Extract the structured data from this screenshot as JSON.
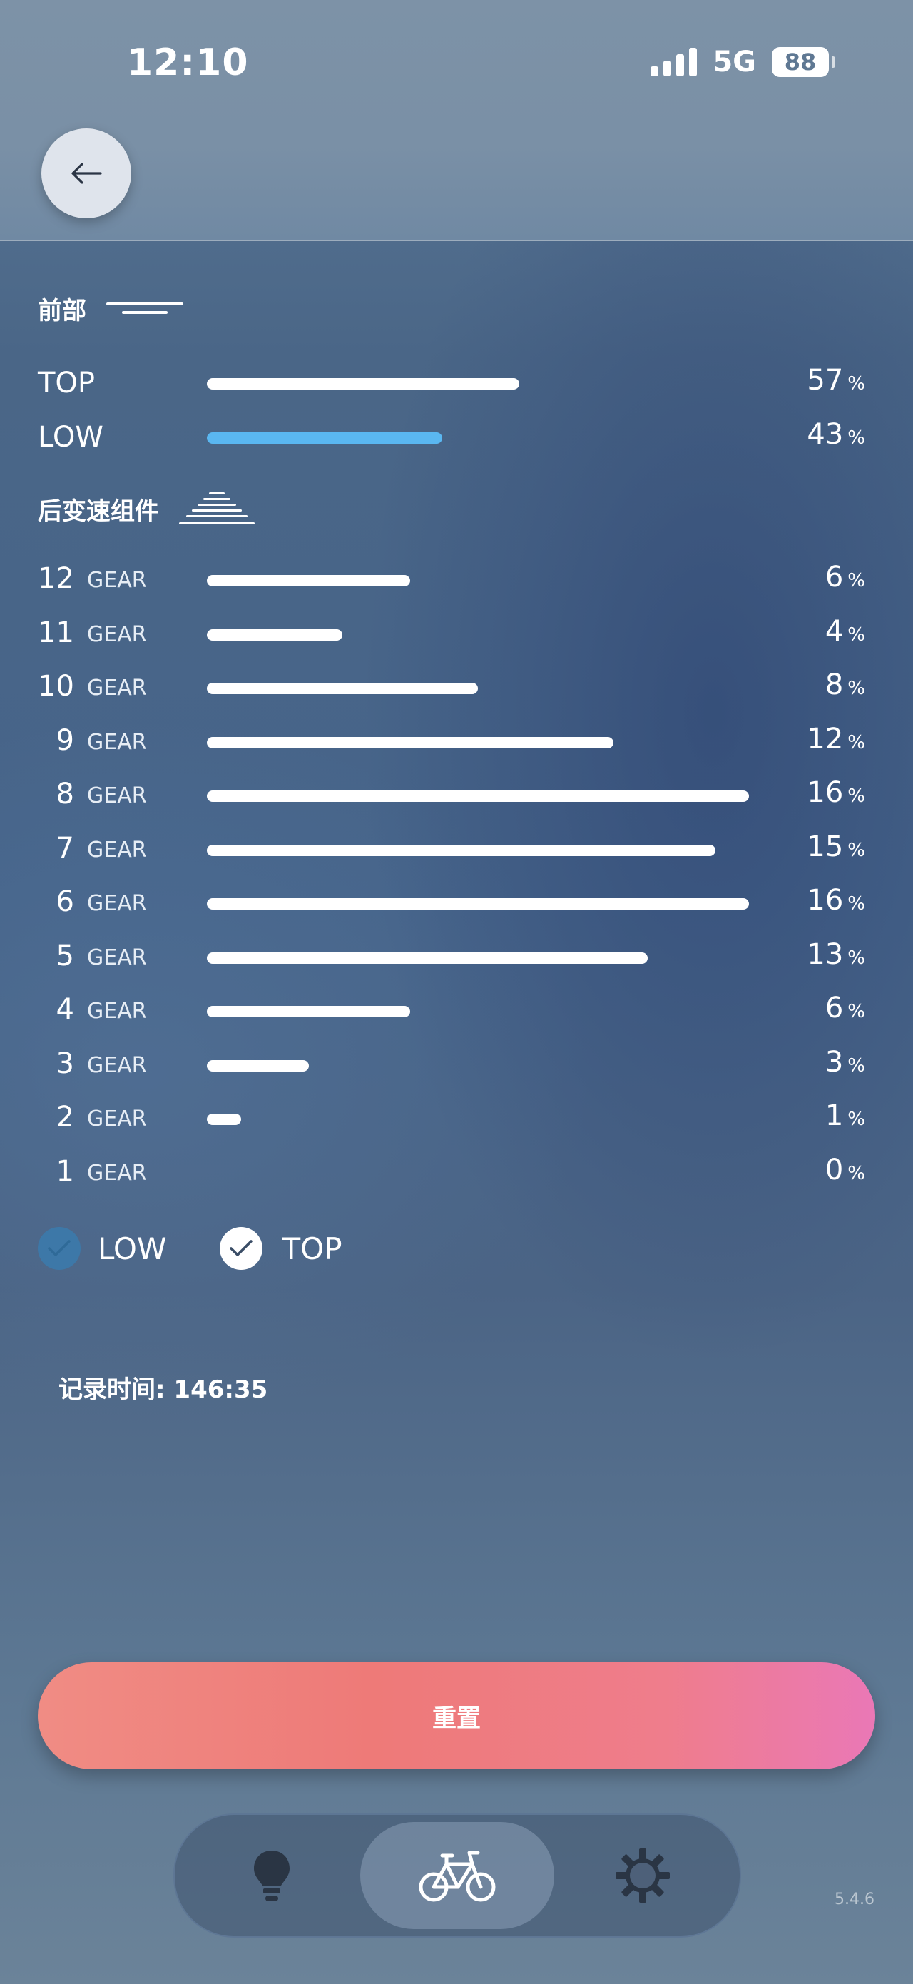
{
  "status_bar": {
    "time": "12:10",
    "network": "5G",
    "battery": "88"
  },
  "header": {
    "title": ""
  },
  "front": {
    "title": "前部",
    "rows": [
      {
        "label": "TOP",
        "value": 57,
        "pct_text": "57",
        "color": "#ffffff"
      },
      {
        "label": "LOW",
        "value": 43,
        "pct_text": "43",
        "color": "#5ab7f1"
      }
    ]
  },
  "rear": {
    "title": "后变速组件",
    "gear_word": "GEAR",
    "rows": [
      {
        "gear": "12",
        "value": 6,
        "pct_text": "6"
      },
      {
        "gear": "11",
        "value": 4,
        "pct_text": "4"
      },
      {
        "gear": "10",
        "value": 8,
        "pct_text": "8"
      },
      {
        "gear": "9",
        "value": 12,
        "pct_text": "12"
      },
      {
        "gear": "8",
        "value": 16,
        "pct_text": "16"
      },
      {
        "gear": "7",
        "value": 15,
        "pct_text": "15"
      },
      {
        "gear": "6",
        "value": 16,
        "pct_text": "16"
      },
      {
        "gear": "5",
        "value": 13,
        "pct_text": "13"
      },
      {
        "gear": "4",
        "value": 6,
        "pct_text": "6"
      },
      {
        "gear": "3",
        "value": 3,
        "pct_text": "3"
      },
      {
        "gear": "2",
        "value": 1,
        "pct_text": "1"
      },
      {
        "gear": "1",
        "value": 0,
        "pct_text": "0"
      }
    ]
  },
  "percent_sign": "%",
  "legend": {
    "low_label": "LOW",
    "top_label": "TOP",
    "low_color": "#3d78a8",
    "top_color": "#ffffff"
  },
  "record": {
    "text": "记录时间: 146:35"
  },
  "reset_label": "重置",
  "nav": {
    "items": [
      "bulb-icon",
      "bike-icon",
      "gear-icon"
    ],
    "active": 1
  },
  "version": "5.4.6"
}
